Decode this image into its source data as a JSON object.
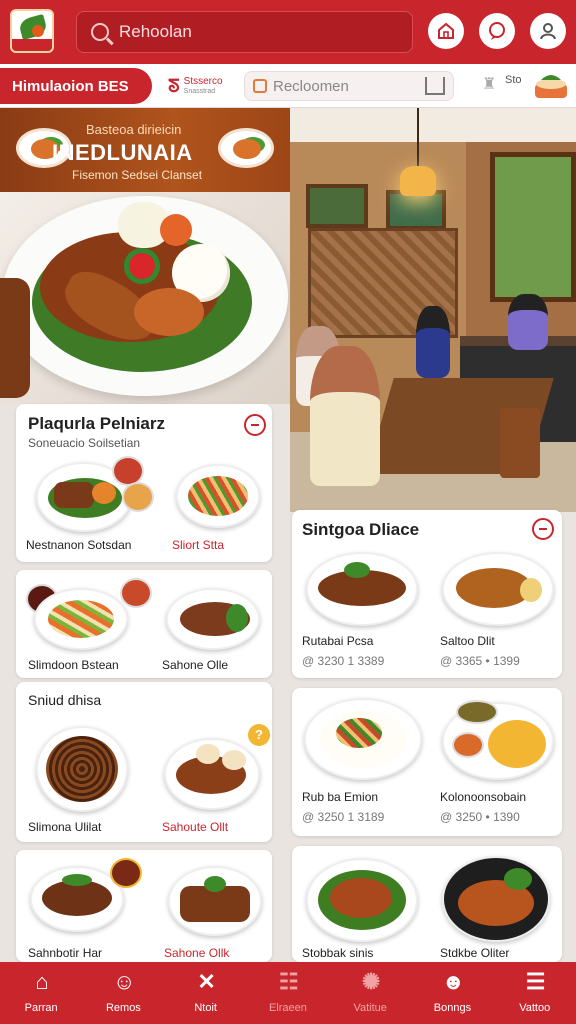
{
  "header": {
    "search_placeholder": "Rehoolan",
    "icons": [
      "home-icon",
      "chat-icon",
      "profile-icon"
    ]
  },
  "subbar": {
    "pill_label": "Himulaoion BES",
    "brand_top": "Stsserco",
    "brand_bottom": "Snasstrad",
    "search_placeholder": "Recloomen",
    "mini_label": "Sto"
  },
  "promo": {
    "line1": "Basteoa dirieicin",
    "line2": "INEDLUNAIA",
    "line3": "Fisemon Sedsei Clanset"
  },
  "card_left": {
    "title": "Plaqurla Pelniarz",
    "subtitle": "Soneuacio Soilsetian",
    "dishes": [
      {
        "label": "Nestnanon Sotsdan",
        "red": false
      },
      {
        "label": "Sliort  Stta",
        "red": true
      },
      {
        "label": "Slimdoon Bstean",
        "red": false
      },
      {
        "label": "Sahone  Olle",
        "red": false
      },
      {
        "label": "Slimona Ulilat",
        "red": false
      },
      {
        "label": "Sahoute  Ollt",
        "red": true
      },
      {
        "label": "Sahnbotir  Har",
        "red": false
      },
      {
        "label": "Sahone  Ollk",
        "red": true
      }
    ],
    "section2_title": "Sniud dhisa",
    "badge": "?"
  },
  "card_right": {
    "title": "Sintgoa Dliace",
    "dishes": [
      {
        "label": "Rutabai Pcsa",
        "price": "@ 3230 1 3389"
      },
      {
        "label": "Saltoo Dlit",
        "price": "@ 3365 • 1399"
      },
      {
        "label": "Rub ba Emion",
        "price": "@ 3250 1 3189"
      },
      {
        "label": "Kolonoonsobain",
        "price": "@ 3250 • 1390"
      },
      {
        "label": "Stobbak sinis",
        "price": ""
      },
      {
        "label": "Stdkbe Oliter",
        "price": ""
      }
    ]
  },
  "bottom_nav": [
    {
      "label": "Parran",
      "icon": "home-icon",
      "glyph": "⌂",
      "dim": false
    },
    {
      "label": "Remos",
      "icon": "menu-plate-icon",
      "glyph": "☺",
      "dim": false
    },
    {
      "label": "Ntoit",
      "icon": "utensils-icon",
      "glyph": "✕",
      "dim": false
    },
    {
      "label": "Elraeen",
      "icon": "calendar-icon",
      "glyph": "☷",
      "dim": true
    },
    {
      "label": "Vatitue",
      "icon": "gear-icon",
      "glyph": "✺",
      "dim": true
    },
    {
      "label": "Bonngs",
      "icon": "chef-icon",
      "glyph": "☻",
      "dim": false
    },
    {
      "label": "Vattoo",
      "icon": "list-icon",
      "glyph": "☰",
      "dim": false
    }
  ],
  "colors": {
    "brand_red": "#c8262c",
    "accent_orange": "#e07b3c",
    "badge_yellow": "#f2b632"
  }
}
